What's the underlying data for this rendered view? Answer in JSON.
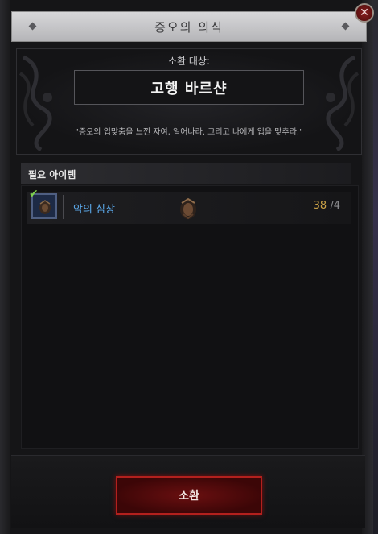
{
  "dialog": {
    "title": "증오의 의식",
    "close_label": "✕"
  },
  "header": {
    "summon_label": "소환 대상:",
    "target_name": "고행 바르샨",
    "quote": "\"증오의 입맞춤을 느낀 자여, 일어나라. 그리고 나에게 입을 맞추라.\""
  },
  "requirements": {
    "title": "필요 아이템",
    "items": [
      {
        "name": "악의 심장",
        "have": "38",
        "need": "/4",
        "checked": "✔",
        "icon": "malignant-heart-icon"
      }
    ]
  },
  "actions": {
    "summon_button": "소환"
  },
  "colors": {
    "accent_red": "#b3201d",
    "item_blue": "#5aa7e8",
    "count_gold": "#c8a046",
    "check_green": "#7cd24a"
  }
}
